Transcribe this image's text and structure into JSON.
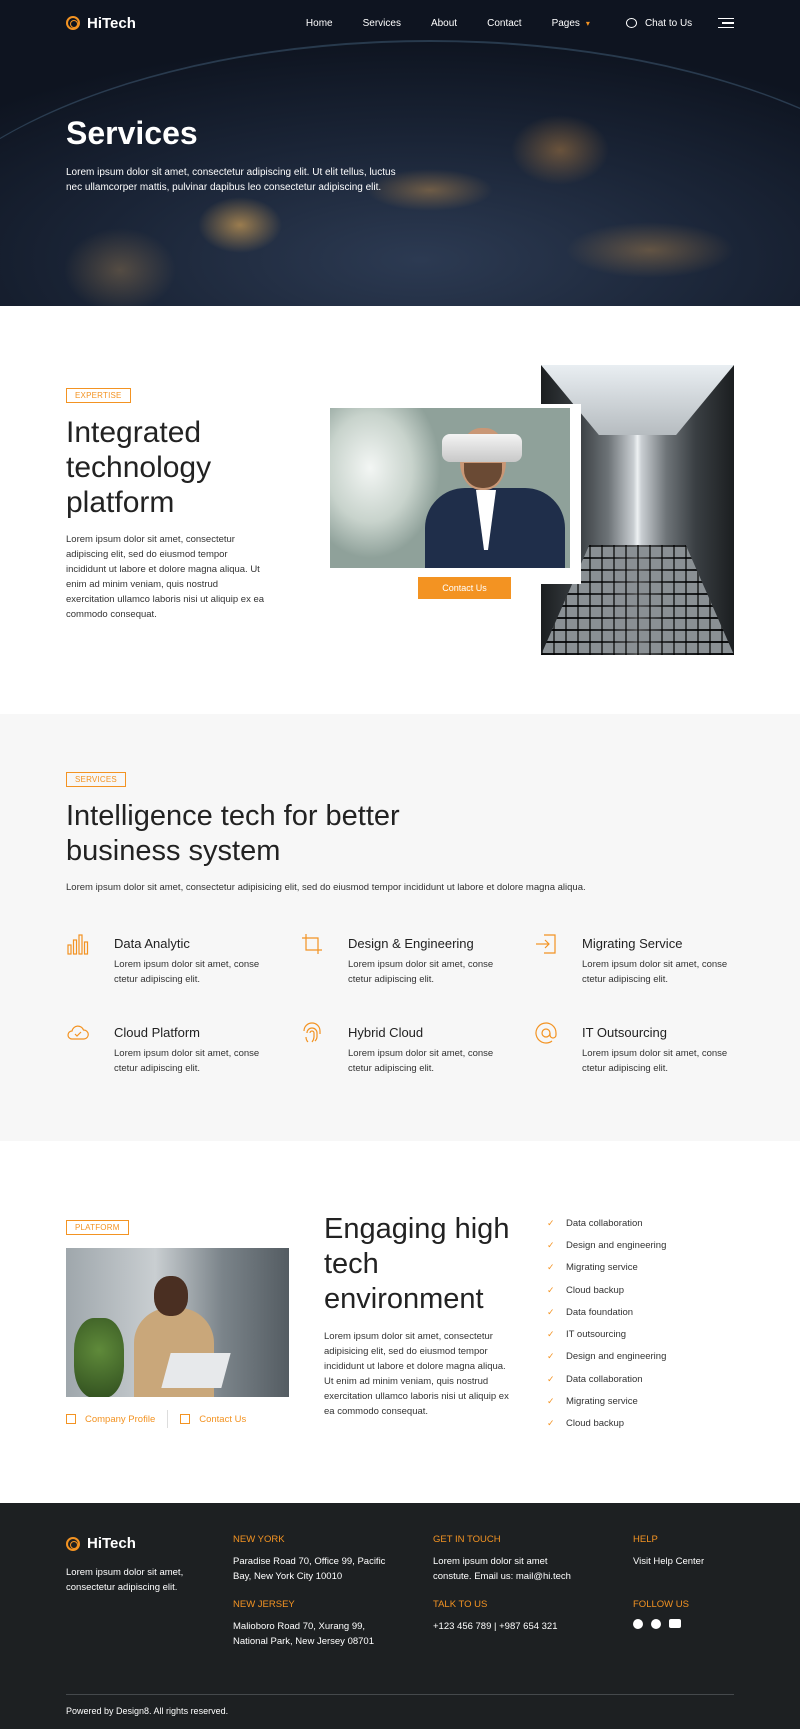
{
  "colors": {
    "accent": "#f39322",
    "footer_bg": "#1d2022",
    "section_bg": "#f7f7f7"
  },
  "brand": {
    "name": "HiTech"
  },
  "nav": {
    "items": [
      "Home",
      "Services",
      "About",
      "Contact",
      "Pages"
    ],
    "chat_label": "Chat to Us"
  },
  "hero": {
    "title": "Services",
    "text": "Lorem ipsum dolor sit amet, consectetur adipiscing elit. Ut elit tellus, luctus nec ullamcorper mattis, pulvinar dapibus leo consectetur adipiscing elit."
  },
  "expertise": {
    "tag": "EXPERTISE",
    "title": "Integrated technology platform",
    "text": "Lorem ipsum dolor sit amet, consectetur adipiscing elit, sed do eiusmod tempor incididunt ut labore et dolore magna aliqua. Ut enim ad minim veniam, quis nostrud exercitation ullamco laboris nisi ut aliquip ex ea commodo consequat.",
    "button": "Contact Us"
  },
  "services": {
    "tag": "SERVICES",
    "title": "Intelligence tech for better business system",
    "text": "Lorem ipsum dolor sit amet, consectetur adipisicing elit, sed do eiusmod tempor incididunt ut labore et dolore magna aliqua.",
    "items": [
      {
        "icon": "bar-chart-icon",
        "title": "Data Analytic",
        "text": "Lorem ipsum dolor sit amet, conse ctetur adipiscing elit."
      },
      {
        "icon": "crop-icon",
        "title": "Design & Engineering",
        "text": "Lorem ipsum dolor sit amet, conse ctetur adipiscing elit."
      },
      {
        "icon": "login-icon",
        "title": "Migrating Service",
        "text": "Lorem ipsum dolor sit amet, conse ctetur adipiscing elit."
      },
      {
        "icon": "cloud-check-icon",
        "title": "Cloud Platform",
        "text": "Lorem ipsum dolor sit amet, conse ctetur adipiscing elit."
      },
      {
        "icon": "fingerprint-icon",
        "title": "Hybrid Cloud",
        "text": "Lorem ipsum dolor sit amet, conse ctetur adipiscing elit."
      },
      {
        "icon": "at-sign-icon",
        "title": "IT Outsourcing",
        "text": "Lorem ipsum dolor sit amet, conse ctetur adipiscing elit."
      }
    ]
  },
  "platform": {
    "tag": "PLATFORM",
    "title": "Engaging high tech environment",
    "text": "Lorem ipsum dolor sit amet, consectetur adipisicing elit, sed do eiusmod tempor incididunt ut labore et dolore magna aliqua. Ut enim ad minim veniam, quis nostrud exercitation ullamco laboris nisi ut aliquip ex ea commodo consequat.",
    "links": [
      "Company Profile",
      "Contact Us"
    ],
    "checklist": [
      "Data collaboration",
      "Design and engineering",
      "Migrating service",
      "Cloud backup",
      "Data foundation",
      "IT outsourcing",
      "Design and engineering",
      "Data collaboration",
      "Migrating service",
      "Cloud backup"
    ]
  },
  "footer": {
    "about": "Lorem ipsum dolor sit amet, consectetur adipiscing elit.",
    "new_york": {
      "title": "NEW YORK",
      "text": "Paradise Road 70, Office 99, Pacific Bay,  New York City 10010"
    },
    "new_jersey": {
      "title": "NEW JERSEY",
      "text": "Malioboro Road 70, Xurang 99, National Park, New Jersey 08701"
    },
    "get_in_touch": {
      "title": "GET IN TOUCH",
      "text": "Lorem ipsum dolor sit amet constute. Email us: mail@hi.tech"
    },
    "talk_to_us": {
      "title": "TALK TO US",
      "text": "+123 456 789 | +987 654 321"
    },
    "help": {
      "title": "HELP",
      "text": "Visit Help Center"
    },
    "follow_us": {
      "title": "FOLLOW US",
      "icons": [
        "facebook-icon",
        "twitter-icon",
        "youtube-icon"
      ]
    },
    "copyright": "Powered by Design8. All rights reserved."
  }
}
